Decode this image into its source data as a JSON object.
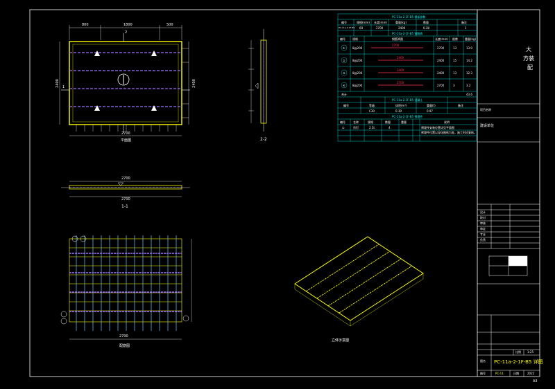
{
  "labels": {
    "plan_view": "平面图",
    "section_11": "1-1",
    "section_22": "2-2",
    "rebar_plan": "配筋图",
    "isometric": "立体示意图",
    "sheet_no": "A3"
  },
  "dims": {
    "top_left": "800",
    "top_mid": "1800",
    "top_right": "500",
    "bottom": "2700",
    "side_left": "2400",
    "side_right": "2400",
    "s11_top": "2700",
    "s11_bottom": "2700",
    "rebar_bottom": "2700",
    "section_mark_1": "1",
    "section_mark_2": "2"
  },
  "table": {
    "title1": "PC-11a-2-1F-B5 模板参数",
    "hdr1": [
      "编号",
      "规格(mm)",
      "长度(mm)",
      "重量(kg)",
      "数量",
      "备注"
    ],
    "row1": [
      "PC-11a-2-1F-B5",
      "60",
      "2700",
      "2400",
      "0.38",
      "1"
    ],
    "title2": "PC-11a-2-1F-B5 钢筋表",
    "hdr2": [
      "编号",
      "规格",
      "钢筋简图",
      "长度(mm)",
      "根数",
      "重量(kg)"
    ],
    "rows2": [
      [
        "①",
        "8@200",
        "2700",
        "2700",
        "13",
        "13.9"
      ],
      [
        "②",
        "8@200",
        "2400",
        "2400",
        "15",
        "14.2"
      ],
      [
        "③",
        "8@200",
        "2400",
        "2400",
        "13",
        "12.3"
      ],
      [
        "④",
        "8@200",
        "2700",
        "2700",
        "3",
        "3.2"
      ]
    ],
    "total_label": "合计",
    "total_value": "43.6",
    "title3": "PC-11a-2-1F-B5 混凝土",
    "hdr3": [
      "编号",
      "等级",
      "体积(m³)",
      "重量(t)",
      "备注"
    ],
    "row3": [
      "C30",
      "0.39",
      "0.97",
      "",
      ""
    ],
    "title4": "PC-11a-2-1F-B5 预埋件",
    "hdr4": [
      "编号",
      "名称",
      "规格",
      "数量",
      "重量",
      "说明"
    ],
    "row4": [
      "①",
      "吊钉",
      "2.5t",
      "4",
      "",
      "预埋件安装位置详见平面图"
    ],
    "note": "预埋件位置以深化图纸为准，施工时应复核。"
  },
  "title_block": {
    "company_lines": [
      "大",
      "方装",
      "配"
    ],
    "project_label": "项目名称",
    "subproject": "建设单位",
    "rows": [
      "设计",
      "校对",
      "审核",
      "审定",
      "专业",
      "负责"
    ],
    "sheet_title_label": "图名",
    "drawing_title": "PC-11a-2-1F-B5 详图",
    "date_label": "日期",
    "date_value": "2022",
    "scale_label": "比例",
    "scale_value": "1:25",
    "drawing_no_label": "图号",
    "drawing_no": "PC-11"
  }
}
